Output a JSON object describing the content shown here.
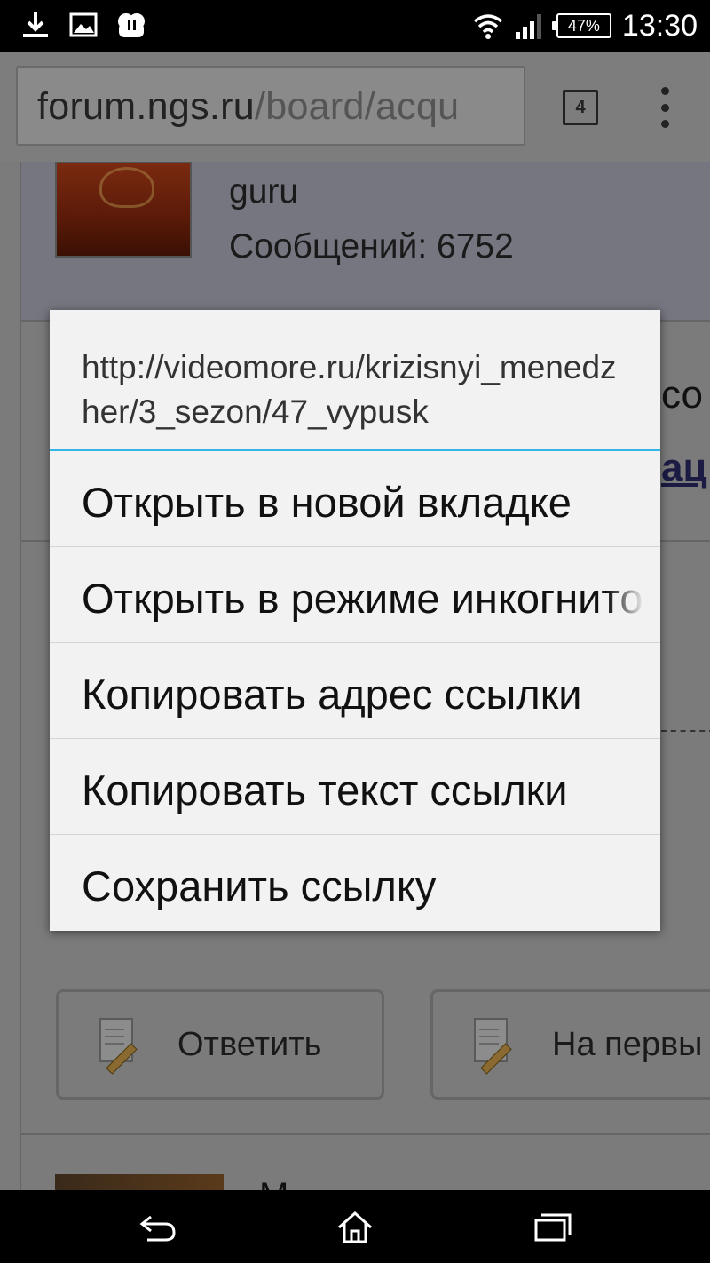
{
  "status_bar": {
    "battery": "47%",
    "time": "13:30",
    "icons": [
      "download-icon",
      "image-icon",
      "app-icon",
      "wifi-icon",
      "signal-icon",
      "battery-icon"
    ]
  },
  "toolbar": {
    "url_domain": "forum.ngs.ru",
    "url_path": "/board/acqu",
    "tab_count": "4"
  },
  "page": {
    "user_rank": "guru",
    "user_messages": "Сообщений: 6752",
    "edge_text_1": "со",
    "edge_text_2": "ац",
    "reply_button": "Ответить",
    "first_button": "На первы",
    "next_name": "M"
  },
  "context_menu": {
    "link_url": "http://videomore.ru/krizisnyi_menedzher/3_sezon/47_vypusk",
    "items": [
      {
        "label": "Открыть в новой вкладке"
      },
      {
        "label": "Открыть в режиме инкогнито"
      },
      {
        "label": "Копировать адрес ссылки"
      },
      {
        "label": "Копировать текст ссылки"
      },
      {
        "label": "Сохранить ссылку"
      }
    ]
  },
  "nav_bar": {
    "buttons": [
      "back-icon",
      "home-icon",
      "recent-apps-icon"
    ]
  }
}
